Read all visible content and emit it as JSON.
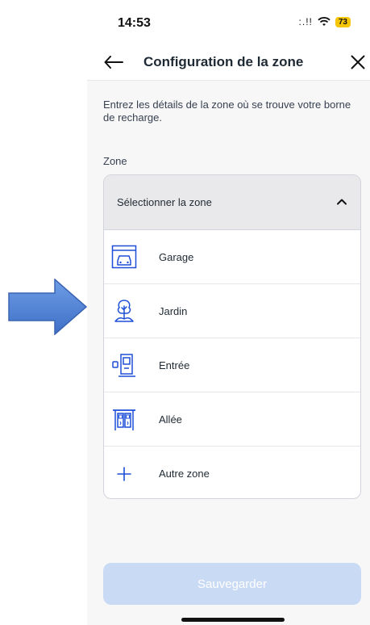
{
  "annotation": {
    "arrow_color": "#4a7fd4"
  },
  "status_bar": {
    "time": "14:53",
    "signal": ":.!!",
    "battery": "73"
  },
  "nav": {
    "title": "Configuration de la zone",
    "back_icon": "arrow-left-icon",
    "close_icon": "close-icon"
  },
  "intro_text": "Entrez les détails de la zone où se trouve votre borne de recharge.",
  "zone_label": "Zone",
  "dropdown": {
    "placeholder": "Sélectionner la zone",
    "expanded": true,
    "options": [
      {
        "label": "Garage",
        "icon": "garage-icon"
      },
      {
        "label": "Jardin",
        "icon": "tree-icon"
      },
      {
        "label": "Entrée",
        "icon": "entrance-icon"
      },
      {
        "label": "Allée",
        "icon": "driveway-icon"
      },
      {
        "label": "Autre zone",
        "icon": "plus-icon"
      }
    ]
  },
  "save_button": {
    "label": "Sauvegarder",
    "enabled": false
  },
  "colors": {
    "accent": "#1d4ed8",
    "button_disabled": "#c9daf5",
    "battery": "#f6c60a"
  }
}
